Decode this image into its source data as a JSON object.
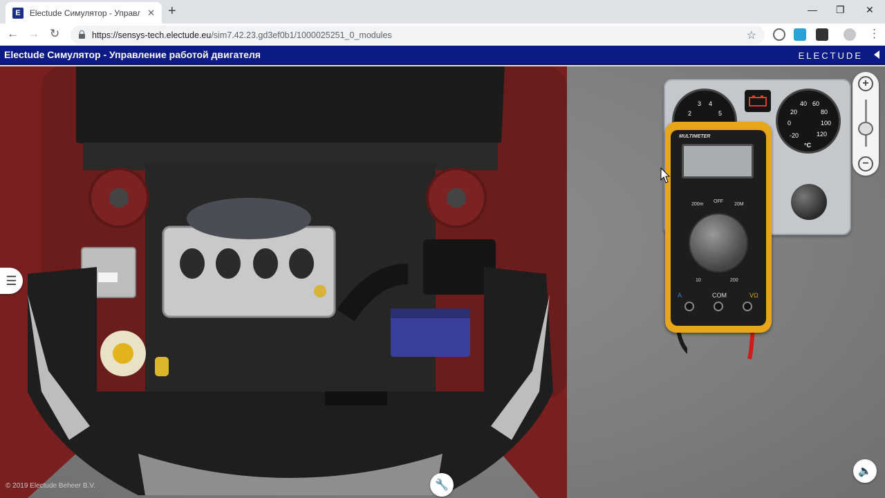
{
  "browser": {
    "tab_title": "Electude Симулятор - Управлен",
    "favicon_letter": "E",
    "url_host": "https://sensys-tech.electude.eu",
    "url_path": "/sim7.42.23.gd3ef0b1/1000025251_0_modules"
  },
  "app": {
    "title": "Electude Симулятор - Управление работой двигателя",
    "brand": "ELECTUDE",
    "copyright": "© 2019 Electude Beheer B.V."
  },
  "dashboard": {
    "rpm_ticks": [
      "2",
      "3",
      "4",
      "5"
    ],
    "temp_ticks": [
      "-20",
      "0",
      "20",
      "40",
      "60",
      "80",
      "100",
      "120"
    ],
    "temp_unit": "°C"
  },
  "multimeter": {
    "name": "MULTIMETER",
    "labels": [
      "200m",
      "OFF",
      "20M",
      "10",
      "200",
      "COM",
      "A",
      "VΩ"
    ]
  },
  "icons": [
    "hamburger-menu-icon",
    "wrench-icon",
    "speaker-icon",
    "zoom-in-icon",
    "zoom-out-icon"
  ],
  "colors": {
    "app_bar": "#0c1a86",
    "multimeter_body": "#e7a51a"
  }
}
